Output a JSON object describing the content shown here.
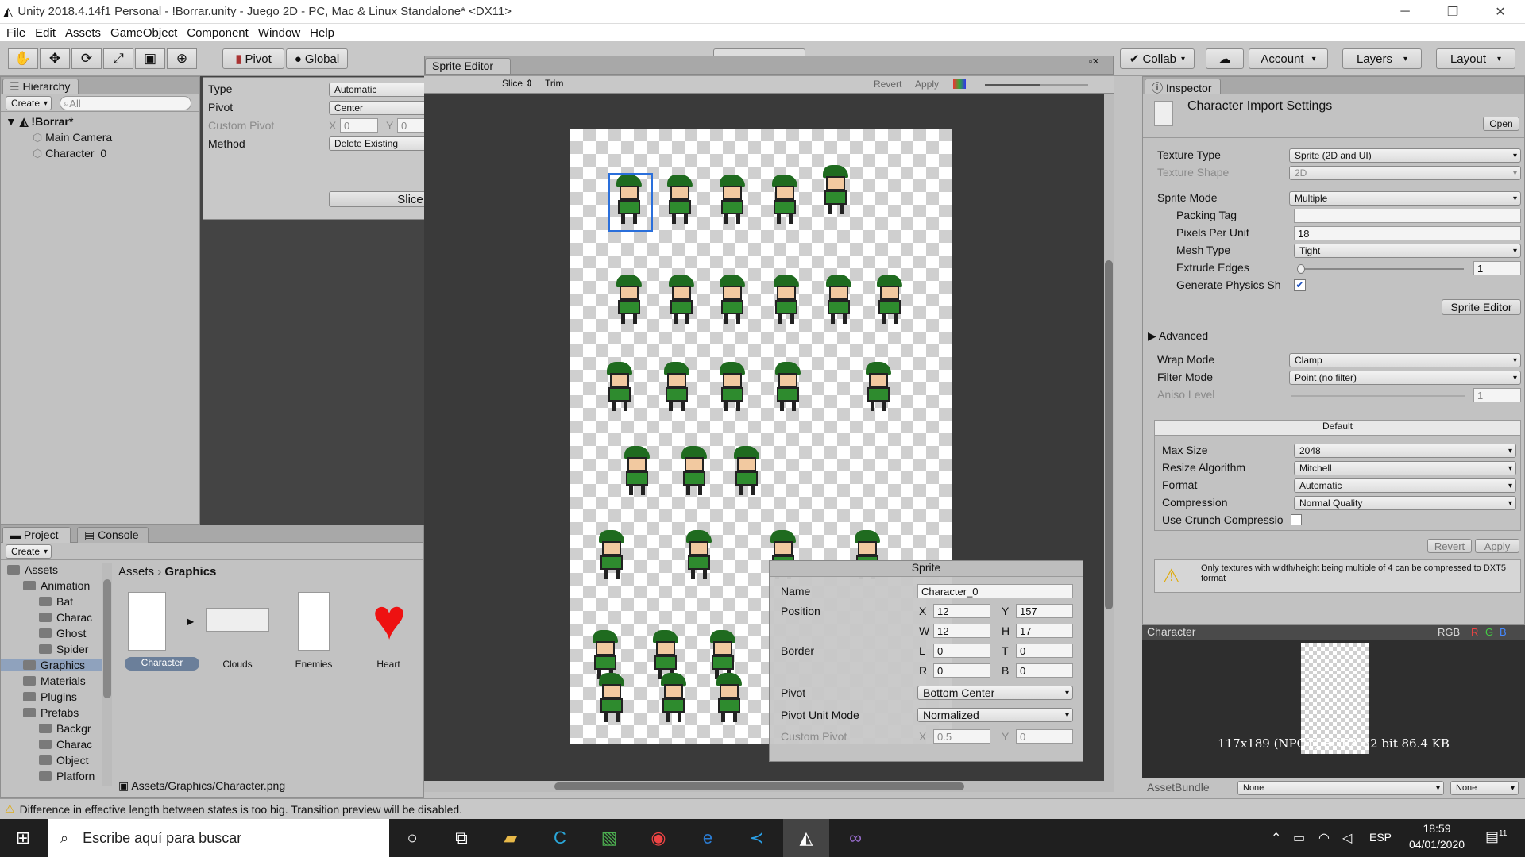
{
  "window": {
    "title": "Unity 2018.4.14f1 Personal - !Borrar.unity - Juego 2D - PC, Mac & Linux Standalone* <DX11>"
  },
  "menu": [
    "File",
    "Edit",
    "Assets",
    "GameObject",
    "Component",
    "Window",
    "Help"
  ],
  "toolbar": {
    "pivot": "Pivot",
    "global": "Global",
    "collab": "Collab",
    "account": "Account",
    "layers": "Layers",
    "layout": "Layout"
  },
  "hierarchy": {
    "tab": "Hierarchy",
    "create": "Create",
    "search_placeholder": "All",
    "scene": "!Borrar*",
    "items": [
      "Main Camera",
      "Character_0"
    ]
  },
  "slice_popup": {
    "type_label": "Type",
    "type_value": "Automatic",
    "pivot_label": "Pivot",
    "pivot_value": "Center",
    "custom_pivot_label": "Custom Pivot",
    "x_label": "X",
    "x_value": "0",
    "y_label": "Y",
    "y_value": "0",
    "method_label": "Method",
    "method_value": "Delete Existing",
    "slice_button": "Slice"
  },
  "sprite_editor": {
    "tab": "Sprite Editor",
    "slice": "Slice",
    "trim": "Trim",
    "revert": "Revert",
    "apply": "Apply"
  },
  "sprite_panel": {
    "title": "Sprite",
    "name_label": "Name",
    "name_value": "Character_0",
    "position_label": "Position",
    "x_label": "X",
    "x": "12",
    "y_label": "Y",
    "y": "157",
    "w_label": "W",
    "w": "12",
    "h_label": "H",
    "h": "17",
    "border_label": "Border",
    "l_label": "L",
    "l": "0",
    "t_label": "T",
    "t": "0",
    "r_label": "R",
    "r": "0",
    "b_label": "B",
    "b": "0",
    "pivot_label": "Pivot",
    "pivot_value": "Bottom Center",
    "pivot_unit_label": "Pivot Unit Mode",
    "pivot_unit_value": "Normalized",
    "custom_pivot_label": "Custom Pivot",
    "cpx_label": "X",
    "cpx": "0.5",
    "cpy_label": "Y",
    "cpy": "0"
  },
  "inspector": {
    "tab": "Inspector",
    "title": "Character Import Settings",
    "open": "Open",
    "texture_type_label": "Texture Type",
    "texture_type": "Sprite (2D and UI)",
    "texture_shape_label": "Texture Shape",
    "texture_shape": "2D",
    "sprite_mode_label": "Sprite Mode",
    "sprite_mode": "Multiple",
    "packing_tag_label": "Packing Tag",
    "packing_tag": "",
    "ppu_label": "Pixels Per Unit",
    "ppu": "18",
    "mesh_type_label": "Mesh Type",
    "mesh_type": "Tight",
    "extrude_label": "Extrude Edges",
    "extrude": "1",
    "physics_label": "Generate Physics Sh",
    "sprite_editor_button": "Sprite Editor",
    "advanced": "Advanced",
    "wrap_label": "Wrap Mode",
    "wrap": "Clamp",
    "filter_label": "Filter Mode",
    "filter": "Point (no filter)",
    "aniso_label": "Aniso Level",
    "aniso": "1",
    "platform_default": "Default",
    "max_size_label": "Max Size",
    "max_size": "2048",
    "resize_label": "Resize Algorithm",
    "resize": "Mitchell",
    "format_label": "Format",
    "format": "Automatic",
    "compression_label": "Compression",
    "compression": "Normal Quality",
    "crunch_label": "Use Crunch Compressio",
    "revert": "Revert",
    "apply": "Apply",
    "warning": "Only textures with width/height being multiple of 4 can be compressed to DXT5 format"
  },
  "preview": {
    "title": "Character",
    "channels": [
      "RGB",
      "R",
      "G",
      "B"
    ],
    "info": "117x189 (NPOT)  RGBA 32 bit   86.4 KB",
    "assetbundle_label": "AssetBundle",
    "assetbundle": "None",
    "variant": "None"
  },
  "project": {
    "tab_project": "Project",
    "tab_console": "Console",
    "create": "Create",
    "tree": [
      {
        "label": "Assets",
        "depth": 0
      },
      {
        "label": "Animation",
        "depth": 1
      },
      {
        "label": "Bat",
        "depth": 2
      },
      {
        "label": "Charac",
        "depth": 2
      },
      {
        "label": "Ghost",
        "depth": 2
      },
      {
        "label": "Spider",
        "depth": 2
      },
      {
        "label": "Graphics",
        "depth": 1
      },
      {
        "label": "Materials",
        "depth": 1
      },
      {
        "label": "Plugins",
        "depth": 1
      },
      {
        "label": "Prefabs",
        "depth": 1
      },
      {
        "label": "Backgr",
        "depth": 2
      },
      {
        "label": "Charac",
        "depth": 2
      },
      {
        "label": "Object",
        "depth": 2
      },
      {
        "label": "Platforn",
        "depth": 2
      }
    ],
    "breadcrumb": [
      "Assets",
      "Graphics"
    ],
    "assets": [
      "Character",
      "Clouds",
      "Enemies",
      "Heart"
    ],
    "footer_path": "Assets/Graphics/Character.png"
  },
  "status": {
    "message": "Difference in effective length between states is too big. Transition preview will be disabled."
  },
  "taskbar": {
    "search_placeholder": "Escribe aquí para buscar",
    "lang": "ESP",
    "time": "18:59",
    "date": "04/01/2020",
    "notif": "11"
  }
}
